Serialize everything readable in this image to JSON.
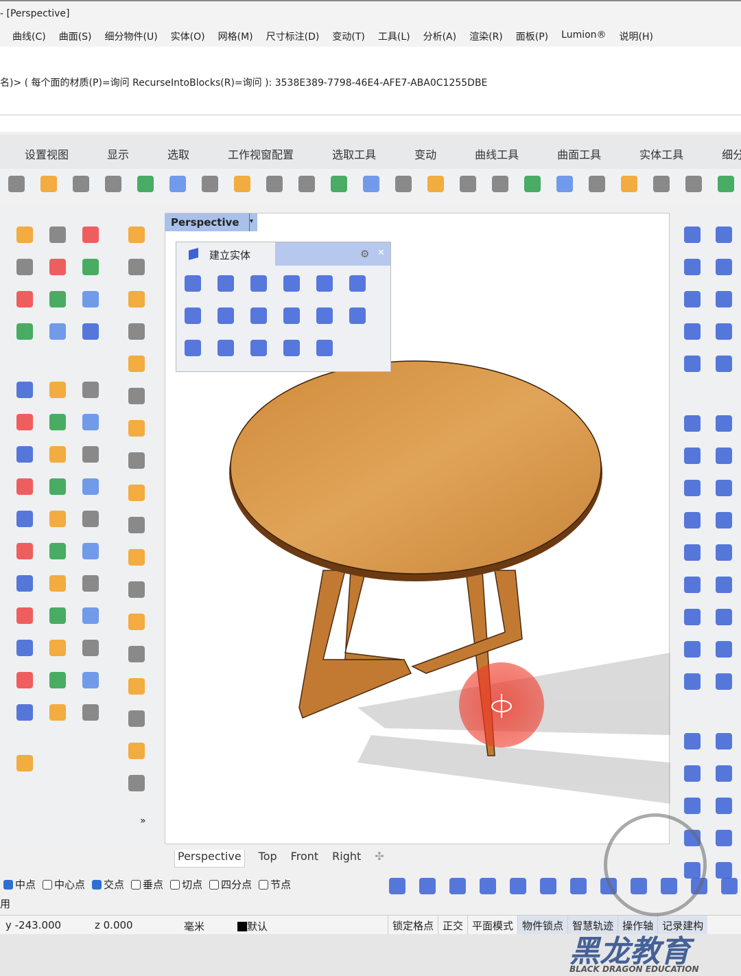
{
  "window": {
    "title": "- [Perspective]"
  },
  "menu": [
    "曲线(C)",
    "曲面(S)",
    "细分物件(U)",
    "实体(O)",
    "网格(M)",
    "尺寸标注(D)",
    "变动(T)",
    "工具(L)",
    "分析(A)",
    "渲染(R)",
    "面板(P)",
    "Lumion®",
    "说明(H)"
  ],
  "command": {
    "history": "名)> ( 每个面的材质(P)=询问  RecurseIntoBlocks(R)=询问 ): 3538E389-7798-46E4-AFE7-ABA0C1255DBE",
    "input": ""
  },
  "toolbar_tabs": [
    "设置视图",
    "显示",
    "选取",
    "工作视窗配置",
    "选取工具",
    "变动",
    "曲线工具",
    "曲面工具",
    "实体工具",
    "细分工"
  ],
  "standard_tools": [
    "new-file",
    "cut",
    "copy",
    "paste",
    "undo",
    "pan",
    "rotate-view",
    "zoom-window",
    "zoom-extents",
    "zoom-selected",
    "zoom-dynamic",
    "rotate-camera",
    "four-viewports",
    "car",
    "grid-plane",
    "point",
    "snap",
    "light",
    "lock",
    "material",
    "color-wheel",
    "render-sphere",
    "shaded-sphere"
  ],
  "viewport": {
    "title": "Perspective",
    "tabs": [
      "Perspective",
      "Top",
      "Front",
      "Right"
    ]
  },
  "solid_panel": {
    "title": "建立实体",
    "tools": [
      "box",
      "cylinder",
      "sphere",
      "ellipsoid",
      "flat-ellipsoid",
      "paraboloid",
      "cone",
      "truncated-cone",
      "pyramid",
      "truncated-pyramid",
      "tube",
      "torus",
      "pipe",
      "curved-pipe",
      "extrude",
      "fillet-edge",
      "solid-boolean"
    ]
  },
  "osnap": [
    {
      "label": "中点",
      "checked": true
    },
    {
      "label": "中心点",
      "checked": false
    },
    {
      "label": "交点",
      "checked": true
    },
    {
      "label": "垂点",
      "checked": false
    },
    {
      "label": "切点",
      "checked": false
    },
    {
      "label": "四分点",
      "checked": false
    },
    {
      "label": "节点",
      "checked": false
    }
  ],
  "osnap_extra": "用",
  "status": {
    "y": "y -243.000",
    "z": "z 0.000",
    "units": "毫米",
    "layer": "默认",
    "toggles": [
      "锁定格点",
      "正交",
      "平面模式",
      "物件锁点",
      "智慧轨迹",
      "操作轴",
      "记录建构"
    ]
  },
  "more_label": "»",
  "watermark": {
    "cn": "黑龙教育",
    "en": "BLACK DRAGON EDUCATION"
  },
  "colors": {
    "accent": "#2f6fd0",
    "viewport_title": "#a9c1ea",
    "wood": "#d89a4a",
    "icon_blue": "#3b62d6",
    "icon_orange": "#f2a020"
  }
}
